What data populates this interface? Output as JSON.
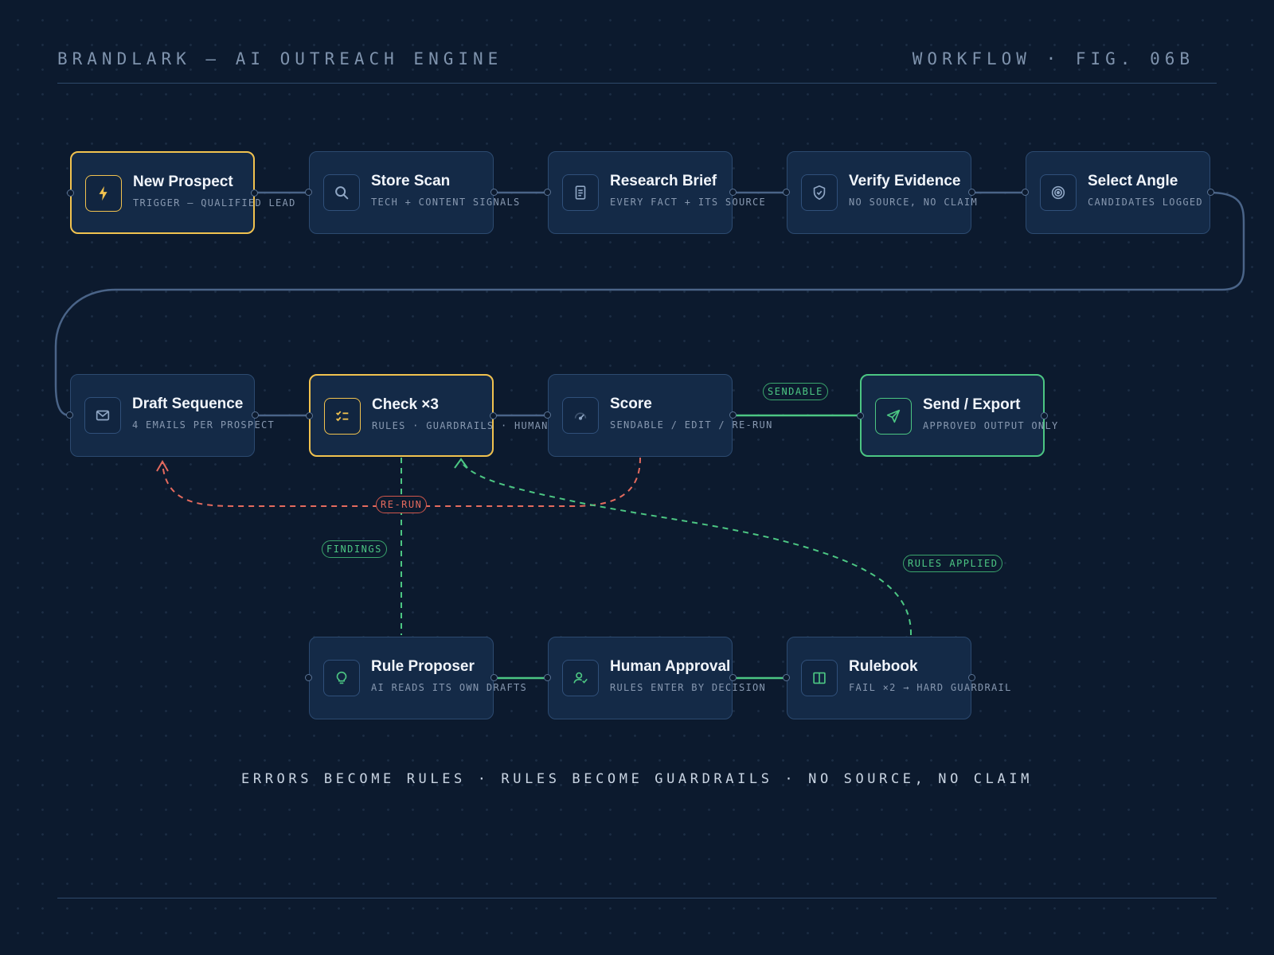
{
  "header": {
    "title": "BRANDLARK — AI OUTREACH ENGINE",
    "figure": "WORKFLOW · FIG. 06B"
  },
  "colors": {
    "background": "#0c1a2e",
    "node_fill": "#142a47",
    "highlight_yellow": "#f1c24f",
    "success_green": "#4cc683",
    "rerun_red": "#e46a5e"
  },
  "nodes": {
    "new_prospect": {
      "title": "New Prospect",
      "subtitle": "TRIGGER — QUALIFIED LEAD",
      "icon": "bolt-icon"
    },
    "store_scan": {
      "title": "Store Scan",
      "subtitle": "TECH + CONTENT SIGNALS",
      "icon": "search-icon"
    },
    "research_brief": {
      "title": "Research Brief",
      "subtitle": "EVERY FACT + ITS SOURCE",
      "icon": "document-icon"
    },
    "verify_evidence": {
      "title": "Verify Evidence",
      "subtitle": "NO SOURCE, NO CLAIM",
      "icon": "shield-check-icon"
    },
    "select_angle": {
      "title": "Select Angle",
      "subtitle": "CANDIDATES LOGGED",
      "icon": "target-icon"
    },
    "draft_sequence": {
      "title": "Draft Sequence",
      "subtitle": "4 EMAILS PER PROSPECT",
      "icon": "mail-icon"
    },
    "check": {
      "title": "Check ×3",
      "subtitle": "RULES · GUARDRAILS · HUMAN",
      "icon": "checklist-icon"
    },
    "score": {
      "title": "Score",
      "subtitle": "SENDABLE / EDIT / RE-RUN",
      "icon": "gauge-icon"
    },
    "send_export": {
      "title": "Send / Export",
      "subtitle": "APPROVED OUTPUT ONLY",
      "icon": "send-icon"
    },
    "rule_proposer": {
      "title": "Rule Proposer",
      "subtitle": "AI READS ITS OWN DRAFTS",
      "icon": "lightbulb-icon"
    },
    "human_approval": {
      "title": "Human Approval",
      "subtitle": "RULES ENTER BY DECISION",
      "icon": "user-check-icon"
    },
    "rulebook": {
      "title": "Rulebook",
      "subtitle": "FAIL ×2 → HARD GUARDRAIL",
      "icon": "book-icon"
    }
  },
  "edge_labels": {
    "sendable": "SENDABLE",
    "rerun": "RE-RUN",
    "findings": "FINDINGS",
    "rules_applied": "RULES APPLIED"
  },
  "footer": {
    "motto": "ERRORS BECOME RULES · RULES BECOME GUARDRAILS · NO SOURCE, NO CLAIM"
  }
}
